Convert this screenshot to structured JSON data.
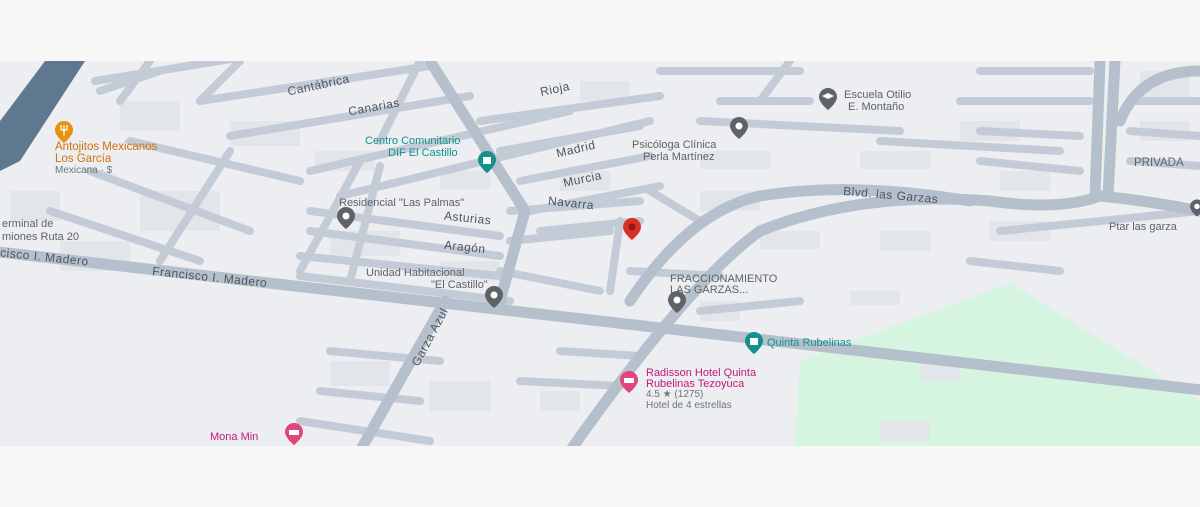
{
  "map": {
    "streets": {
      "cantabrica": "Cantábrica",
      "canarias": "Canarias",
      "rioja": "Rioja",
      "madrid": "Madrid",
      "murcia": "Murcia",
      "navarra": "Navarra",
      "asturias": "Asturias",
      "aragon": "Aragón",
      "francisco_madero": "Francisco I. Madero",
      "francisco_madero_left": "cisco I. Madero",
      "garza_azul": "Garza Azul",
      "blvd_garzas": "Blvd. las Garzas"
    },
    "places": {
      "antojitos_name1": "Antojitos Mexicanos",
      "antojitos_name2": "Los García",
      "antojitos_sub": "Mexicana · $",
      "terminal_1": "erminal de",
      "terminal_2": "miones Ruta 20",
      "centro_1": "Centro Comunitario",
      "centro_2": "DIF El Castillo",
      "residencial": "Residencial \"Las Palmas\"",
      "unidad_1": "Unidad Habitacional",
      "unidad_2": "\"El Castillo\"",
      "psicologa_1": "Psicóloga Clínica",
      "psicologa_2": "Perla Martínez",
      "escuela_1": "Escuela Otilio",
      "escuela_2": "E. Montaño",
      "privada": "PRIVADA",
      "fracc_1": "FRACCIONAMIENTO",
      "fracc_2": "LAS GARZAS...",
      "quinta": "Quinta Rubelinas",
      "radisson_1": "Radisson Hotel Quinta",
      "radisson_2": "Rubelinas Tezoyuca",
      "radisson_rating": "4.5 ★ (1275)",
      "radisson_type": "Hotel de 4 estrellas",
      "mona": "Mona Min",
      "ptar": "Ptar las garza"
    }
  },
  "colors": {
    "road": "#c3ccd6",
    "main_road": "#b5c0cc",
    "block": "#e2e5e9",
    "park": "#d5f5e0",
    "highway": "#5f7890",
    "teal": "#14908f",
    "orange": "#e8920f",
    "pink": "#e0457b",
    "red": "#d93025",
    "gray": "#5f6368"
  },
  "icons": [
    "restaurant-icon",
    "community-center-icon",
    "location-pin-icon",
    "school-icon",
    "hotel-icon",
    "red-marker-icon"
  ]
}
